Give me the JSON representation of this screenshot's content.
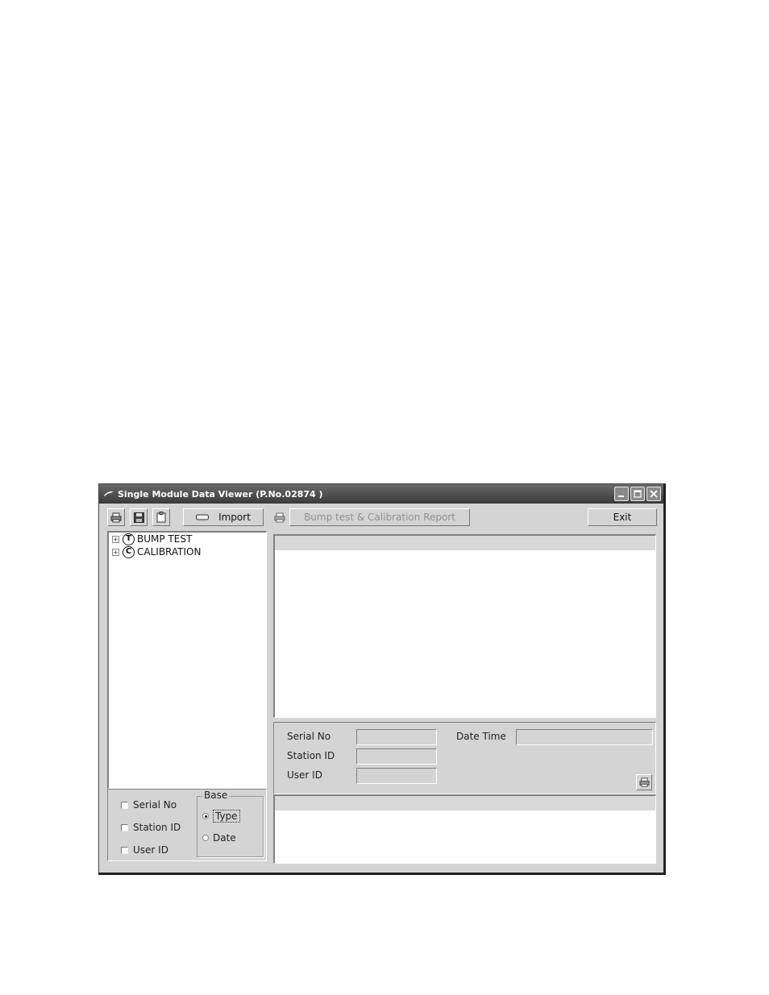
{
  "window": {
    "title": "Single Module Data Viewer (P.No.02874 )",
    "controls": [
      "minimize-icon",
      "maximize-icon",
      "close-icon"
    ]
  },
  "toolbar": {
    "print_icon": "printer-icon",
    "save_icon": "floppy-disk-icon",
    "clipboard_icon": "clipboard-icon",
    "import_label": "Import",
    "report_label": "Bump test & Calibration Report",
    "exit_label": "Exit"
  },
  "tree": {
    "items": [
      {
        "badge": "T",
        "label": "BUMP TEST",
        "expander": "+"
      },
      {
        "badge": "C",
        "label": "CALIBRATION",
        "expander": "+"
      }
    ]
  },
  "filters": {
    "checkboxes": [
      "Serial No",
      "Station ID",
      "User ID"
    ],
    "base": {
      "legend": "Base",
      "options": [
        "Type",
        "Date"
      ],
      "selected": "Type"
    }
  },
  "info": {
    "serial_label": "Serial No",
    "station_label": "Station ID",
    "user_label": "User ID",
    "datetime_label": "Date Time",
    "serial_value": "",
    "station_value": "",
    "user_value": "",
    "datetime_value": ""
  },
  "colors": {
    "titlebar": "#4a4a4a",
    "face": "#d4d4d4",
    "disabled_text": "#8f8f8f"
  }
}
